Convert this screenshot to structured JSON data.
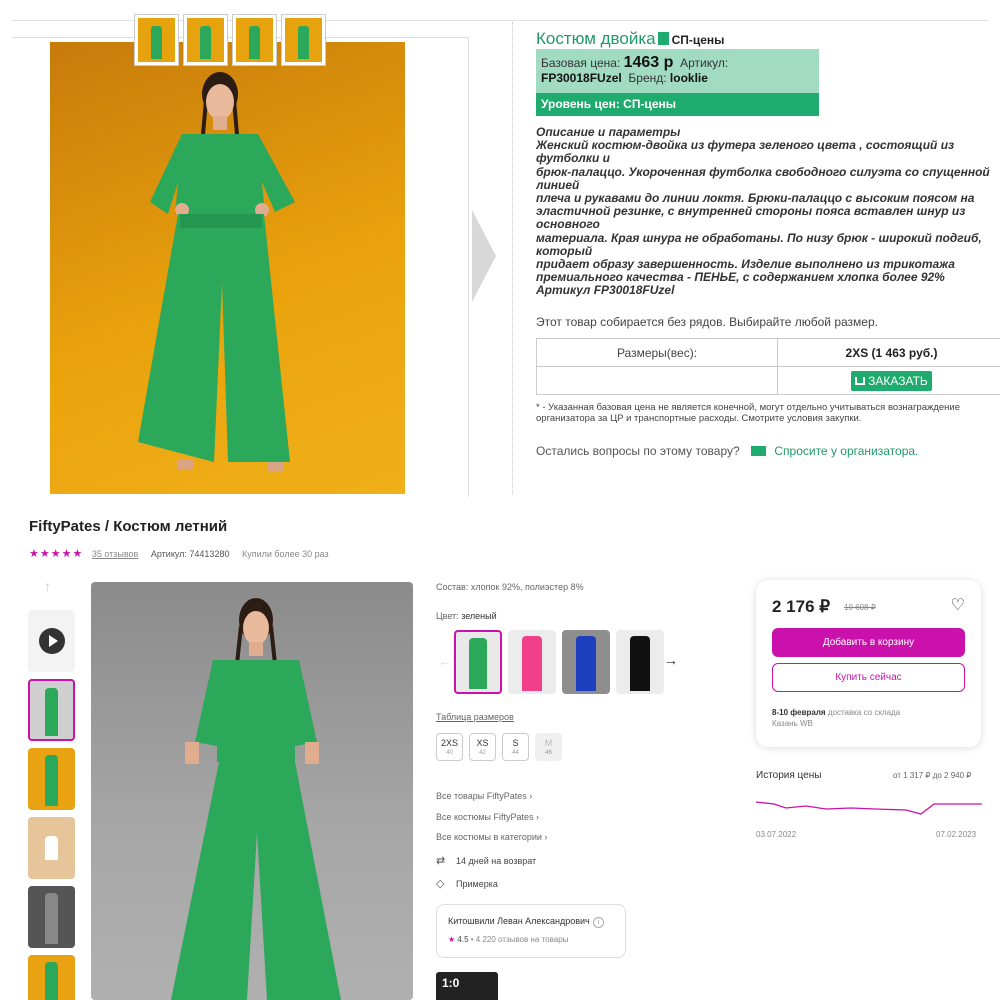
{
  "sp": {
    "title": "Костюм двойка",
    "title_tag": "СП-цены",
    "base_price_label": "Базовая цена:",
    "base_price_value": "1463 р",
    "article_label": "Артикул:",
    "article_value": "FP30018FUzel",
    "brand_label": "Бренд:",
    "brand_value": "looklie",
    "price_level": "Уровень цен: СП-цены",
    "description": "Описание и параметры\nЖенский костюм-двойка из футера зеленого цвета , состоящий из футболки и\nбрюк-палаццо. Укороченная футболка свободного силуэта со спущенной линией\nплеча и рукавами до линии локтя. Брюки-палаццо с высоким поясом на\nэластичной резинке, с внутренней стороны пояса вставлен шнур из основного\nматериала. Края шнура не обработаны. По низу брюк - широкий подгиб, который\nпридает образу завершенность. Изделие выполнено из трикотажа\nпремиального качества - ПЕНЬЕ, с содержанием хлопка более 92%\nАртикул FP30018FUzel\nЦвет Зеленый\nМатериал Футер\nСостав 92%хлопок, 8%полиэст.",
    "note": "Этот товар собирается без рядов. Выбирайте любой размер.",
    "sizes_label": "Размеры(вес):",
    "size_value": "2XS (1 463 руб.)",
    "order_label": "ЗАКАЗАТЬ",
    "disclaimer": "* - Указанная базовая цена не является конечной, могут отдельно учитываться вознаграждение организатора за ЦР и транспортные расходы. Смотрите условия закупки.",
    "question": "Остались вопросы по этому товару?",
    "ask_link": "Спросите у организатора."
  },
  "wb": {
    "title": "FiftyPates / Костюм летний",
    "stars": "★★★★★",
    "reviews": "35 отзывов",
    "article": "Артикул: 74413280",
    "bought": "Купили более 30 раз",
    "composition": "Состав: хлопок 92%, полиэстер 8%",
    "color_label": "Цвет:",
    "color_value": "зеленый",
    "size_table": "Таблица размеров",
    "sizes": [
      {
        "label": "2XS",
        "num": "40"
      },
      {
        "label": "XS",
        "num": "42"
      },
      {
        "label": "S",
        "num": "44"
      },
      {
        "label": "M",
        "num": "46"
      }
    ],
    "links": [
      "Все товары FiftyPates ›",
      "Все костюмы FiftyPates ›",
      "Все костюмы в категории ›"
    ],
    "return": "14 дней на возврат",
    "fitting": "Примерка",
    "seller_name": "Китошвили Леван Александрович",
    "seller_rating": "4.5",
    "seller_reviews": "• 4 220 отзывов на товары",
    "promo": "1:0",
    "price": "2 176 ₽",
    "old_price": "10 608 ₽",
    "cart_label": "Добавить в корзину",
    "buy_label": "Купить сейчас",
    "delivery_date": "8-10 февраля",
    "delivery_text": "доставка со склада",
    "delivery_city": "Казань WB",
    "history_title": "История цены",
    "history_range": "от 1 317 ₽ до 2 940 ₽",
    "history_from": "03.07.2022",
    "history_to": "07.02.2023"
  },
  "colors": {
    "accent_green": "#1faa6e",
    "wb_purple": "#cb11ab",
    "swatch_green": "#2ba85a",
    "swatch_pink": "#f0408a",
    "swatch_blue": "#1c3fbf",
    "swatch_black": "#111111"
  }
}
